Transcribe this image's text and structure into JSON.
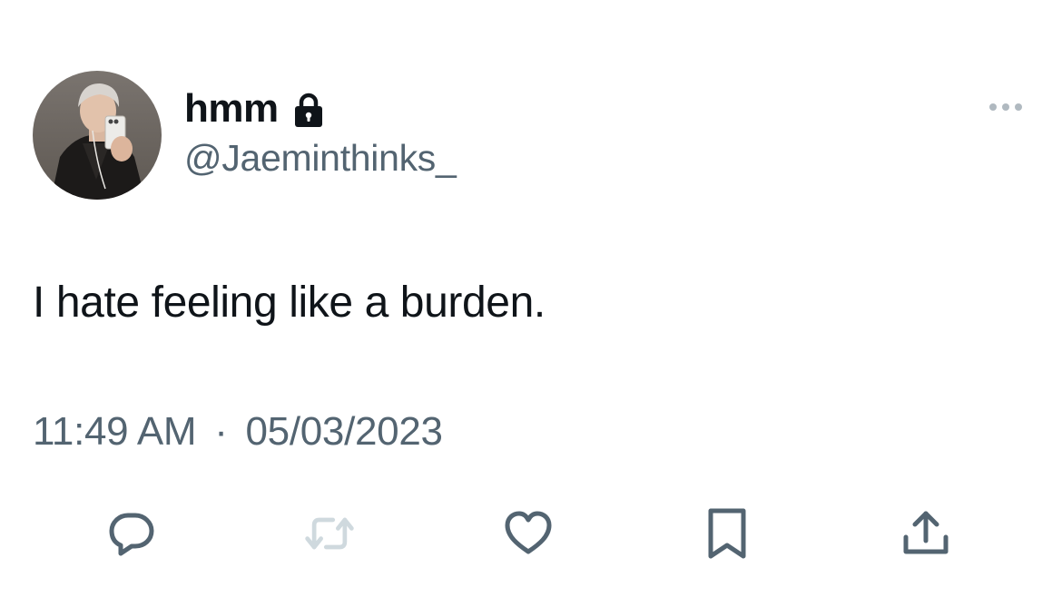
{
  "user": {
    "display_name": "hmm",
    "handle": "@Jaeminthinks_",
    "protected_icon": "lock-icon",
    "avatar_icon": "profile-photo"
  },
  "tweet": {
    "text": "I hate feeling like a burden.",
    "time": "11:49 AM",
    "separator": "·",
    "date": "05/03/2023"
  },
  "actions": [
    {
      "name": "reply",
      "icon": "reply-icon"
    },
    {
      "name": "retweet",
      "icon": "retweet-icon",
      "state": "disabled"
    },
    {
      "name": "like",
      "icon": "heart-icon"
    },
    {
      "name": "bookmark",
      "icon": "bookmark-icon"
    },
    {
      "name": "share",
      "icon": "share-icon"
    }
  ],
  "menu": {
    "icon": "more-icon"
  },
  "colors": {
    "text_primary": "#0f1419",
    "text_secondary": "#536471",
    "icon": "#536471",
    "icon_disabled": "#cfd9de",
    "background": "#ffffff"
  }
}
